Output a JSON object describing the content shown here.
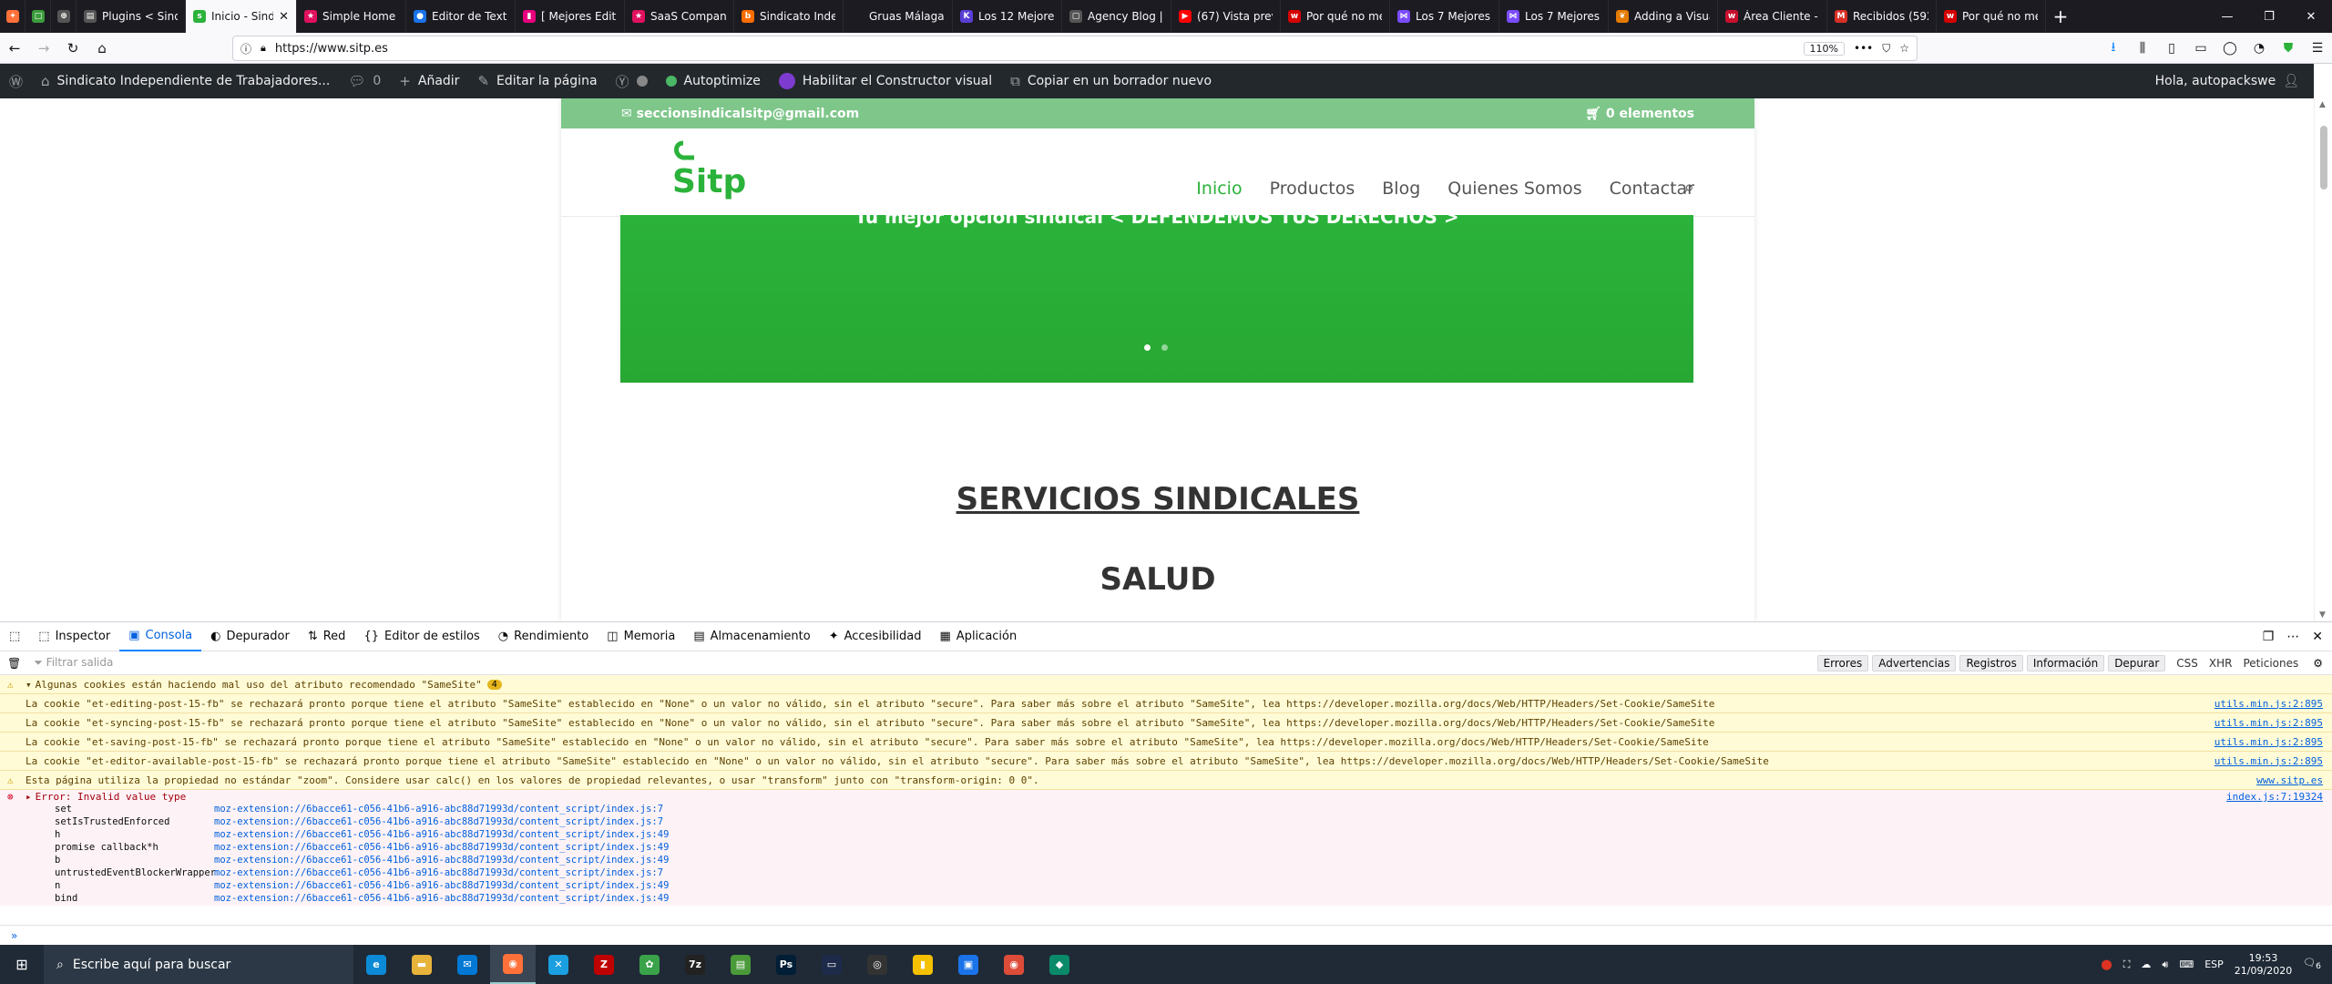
{
  "browser": {
    "tabs": [
      {
        "title": "",
        "color": "#ff7139",
        "glyph": "✦",
        "pinned": true
      },
      {
        "title": "",
        "color": "#3a9b3a",
        "glyph": "□",
        "pinned": true
      },
      {
        "title": "",
        "color": "#555",
        "glyph": "⊕",
        "pinned": true
      },
      {
        "title": "Plugins < Sind",
        "color": "#555",
        "glyph": "▤"
      },
      {
        "title": "Inicio - Sindi",
        "color": "#2bb23a",
        "glyph": "s",
        "active": true
      },
      {
        "title": "Simple Home P",
        "color": "#e0115f",
        "glyph": "★"
      },
      {
        "title": "Editor de Texto",
        "color": "#1a73e8",
        "glyph": "●"
      },
      {
        "title": "[ Mejores Edit",
        "color": "#e6007e",
        "glyph": "▮"
      },
      {
        "title": "SaaS Company",
        "color": "#e0115f",
        "glyph": "★"
      },
      {
        "title": "Sindicato Indep",
        "color": "#ff6d00",
        "glyph": "b"
      },
      {
        "title": "Gruas Málaga, desd",
        "color": "#1c1b22",
        "glyph": ""
      },
      {
        "title": "Los 12 Mejores",
        "color": "#5a3fd6",
        "glyph": "K"
      },
      {
        "title": "Agency Blog | J",
        "color": "#555",
        "glyph": "▢"
      },
      {
        "title": "(67) Vista previ",
        "color": "#ff0000",
        "glyph": "▶"
      },
      {
        "title": "Por qué no me",
        "color": "#d60000",
        "glyph": "w"
      },
      {
        "title": "Los 7 Mejores F",
        "color": "#7a4cff",
        "glyph": "⋈"
      },
      {
        "title": "Los 7 Mejores F",
        "color": "#7a4cff",
        "glyph": "⋈"
      },
      {
        "title": "Adding a Visua",
        "color": "#e57a00",
        "glyph": "❦"
      },
      {
        "title": "Área Cliente - Y",
        "color": "#c8102e",
        "glyph": "w"
      },
      {
        "title": "Recibidos (592",
        "color": "#d93025",
        "glyph": "M"
      },
      {
        "title": "Por qué no me",
        "color": "#d60000",
        "glyph": "w"
      }
    ],
    "new_tab": "+",
    "url_prefix": "https://www.",
    "url_domain": "sitp.es",
    "zoom": "110%",
    "win": {
      "min": "—",
      "max": "❐",
      "close": "✕"
    }
  },
  "wpbar": {
    "site_name": "Sindicato Independiente de Trabajadores...",
    "comments": "0",
    "add": "Añadir",
    "edit": "Editar la página",
    "autoptimize": "Autoptimize",
    "builder": "Habilitar el Constructor visual",
    "copy": "Copiar en un borrador nuevo",
    "greeting": "Hola, autopackswe"
  },
  "site": {
    "email": "seccionsindicalsitp@gmail.com",
    "cart": "0 elementos",
    "menu": [
      "Inicio",
      "Productos",
      "Blog",
      "Quienes Somos",
      "Contactar"
    ],
    "slide_caption": "Tu mejor opción sindical < DEFENDEMOS TUS DERECHOS >",
    "heading_services": "SERVICIOS SINDICALES",
    "heading_health": "SALUD",
    "logo_text": "Sitp",
    "colors": {
      "green": "#2bb23a",
      "topbar": "#7ec68a"
    }
  },
  "devtools": {
    "tabs": [
      {
        "label": "Inspector",
        "icon": "⬚"
      },
      {
        "label": "Consola",
        "icon": "▣",
        "active": true
      },
      {
        "label": "Depurador",
        "icon": "◐"
      },
      {
        "label": "Red",
        "icon": "⇅"
      },
      {
        "label": "Editor de estilos",
        "icon": "{}"
      },
      {
        "label": "Rendimiento",
        "icon": "◔"
      },
      {
        "label": "Memoria",
        "icon": "◫"
      },
      {
        "label": "Almacenamiento",
        "icon": "▤"
      },
      {
        "label": "Accesibilidad",
        "icon": "✦"
      },
      {
        "label": "Aplicación",
        "icon": "▦"
      }
    ],
    "filter_placeholder": "Filtrar salida",
    "filter_buttons": [
      "Errores",
      "Advertencias",
      "Registros",
      "Información",
      "Depurar"
    ],
    "filter_text": [
      "CSS",
      "XHR",
      "Peticiones"
    ],
    "group_header": "Algunas cookies están haciendo mal uso del atributo recomendado \"SameSite\"",
    "group_count": "4",
    "warnings": [
      {
        "msg": "La cookie \"et-editing-post-15-fb\" se rechazará pronto porque tiene el atributo \"SameSite\" establecido en \"None\" o un valor no válido, sin el atributo \"secure\". Para saber más sobre el atributo \"SameSite\", lea https://developer.mozilla.org/docs/Web/HTTP/Headers/Set-Cookie/SameSite",
        "src": "utils.min.js:2:895"
      },
      {
        "msg": "La cookie \"et-syncing-post-15-fb\" se rechazará pronto porque tiene el atributo \"SameSite\" establecido en \"None\" o un valor no válido, sin el atributo \"secure\". Para saber más sobre el atributo \"SameSite\", lea https://developer.mozilla.org/docs/Web/HTTP/Headers/Set-Cookie/SameSite",
        "src": "utils.min.js:2:895"
      },
      {
        "msg": "La cookie \"et-saving-post-15-fb\" se rechazará pronto porque tiene el atributo \"SameSite\" establecido en \"None\" o un valor no válido, sin el atributo \"secure\". Para saber más sobre el atributo \"SameSite\", lea https://developer.mozilla.org/docs/Web/HTTP/Headers/Set-Cookie/SameSite",
        "src": "utils.min.js:2:895"
      },
      {
        "msg": "La cookie \"et-editor-available-post-15-fb\" se rechazará pronto porque tiene el atributo \"SameSite\" establecido en \"None\" o un valor no válido, sin el atributo \"secure\". Para saber más sobre el atributo \"SameSite\", lea https://developer.mozilla.org/docs/Web/HTTP/Headers/Set-Cookie/SameSite",
        "src": "utils.min.js:2:895"
      },
      {
        "msg": "Esta página utiliza la propiedad no estándar \"zoom\". Considere usar calc() en los valores de propiedad relevantes, o usar \"transform\" junto con \"transform-origin: 0 0\".",
        "src": "www.sitp.es"
      }
    ],
    "error": {
      "msg": "Error: Invalid value type",
      "src": "index.js:7:19324"
    },
    "trace": [
      {
        "fn": "set",
        "loc": "moz-extension://6bacce61-c056-41b6-a916-abc88d71993d/content_script/index.js:7"
      },
      {
        "fn": "setIsTrustedEnforced",
        "loc": "moz-extension://6bacce61-c056-41b6-a916-abc88d71993d/content_script/index.js:7"
      },
      {
        "fn": "h",
        "loc": "moz-extension://6bacce61-c056-41b6-a916-abc88d71993d/content_script/index.js:49"
      },
      {
        "fn": "promise callback*h",
        "loc": "moz-extension://6bacce61-c056-41b6-a916-abc88d71993d/content_script/index.js:49"
      },
      {
        "fn": "b",
        "loc": "moz-extension://6bacce61-c056-41b6-a916-abc88d71993d/content_script/index.js:49"
      },
      {
        "fn": "untrustedEventBlockerWrapper",
        "loc": "moz-extension://6bacce61-c056-41b6-a916-abc88d71993d/content_script/index.js:7"
      },
      {
        "fn": "n",
        "loc": "moz-extension://6bacce61-c056-41b6-a916-abc88d71993d/content_script/index.js:49"
      },
      {
        "fn": "bind",
        "loc": "moz-extension://6bacce61-c056-41b6-a916-abc88d71993d/content_script/index.js:49"
      }
    ],
    "prompt": "»"
  },
  "taskbar": {
    "search_placeholder": "Escribe aquí para buscar",
    "apps": [
      {
        "name": "edge",
        "color": "#0c8ad6",
        "glyph": "e"
      },
      {
        "name": "explorer",
        "color": "#e8b33a",
        "glyph": "▬"
      },
      {
        "name": "mail",
        "color": "#0078d4",
        "glyph": "✉"
      },
      {
        "name": "firefox",
        "color": "#ff7139",
        "glyph": "◉",
        "active": true
      },
      {
        "name": "x-app",
        "color": "#1a9fe0",
        "glyph": "✕"
      },
      {
        "name": "filezilla",
        "color": "#bf0000",
        "glyph": "Z"
      },
      {
        "name": "xampp",
        "color": "#3aa34a",
        "glyph": "✿"
      },
      {
        "name": "7zip",
        "color": "#222",
        "glyph": "7z"
      },
      {
        "name": "notepad",
        "color": "#4a9a3a",
        "glyph": "▤"
      },
      {
        "name": "photoshop",
        "color": "#001e36",
        "glyph": "Ps"
      },
      {
        "name": "terminal",
        "color": "#1e2a4a",
        "glyph": "▭"
      },
      {
        "name": "obs",
        "color": "#333",
        "glyph": "◎"
      },
      {
        "name": "sticky",
        "color": "#f4c000",
        "glyph": "▮"
      },
      {
        "name": "remote",
        "color": "#1a73e8",
        "glyph": "▣"
      },
      {
        "name": "chrome",
        "color": "#dd4b39",
        "glyph": "◉"
      },
      {
        "name": "sitp-app",
        "color": "#0b8a6a",
        "glyph": "◆"
      }
    ],
    "lang": "ESP",
    "time": "19:53",
    "date": "21/09/2020",
    "notif": "6"
  }
}
